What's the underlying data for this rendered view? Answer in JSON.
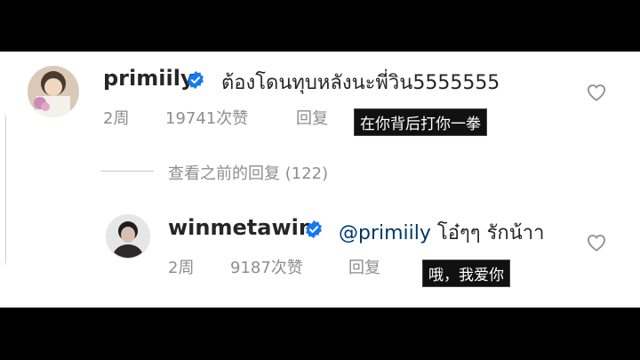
{
  "comments": [
    {
      "username": "primiily",
      "text": "ต้องโดนทุบหลังนะพี่วิน5555555",
      "time": "2周",
      "likes": "19741次赞",
      "reply_label": "回复",
      "subtitle": "在你背后打你一拳"
    }
  ],
  "view_replies": "查看之前的回复 (122)",
  "reply": {
    "username": "winmetawin",
    "mention": "@primiily",
    "text": " โอ๋ๆๆ รักน้าา",
    "time": "2周",
    "likes": "9187次赞",
    "reply_label": "回复",
    "subtitle": "哦，我爱你"
  },
  "colors": {
    "verified": "#1877f2",
    "meta": "#8e8e8e",
    "mention": "#00376b"
  }
}
